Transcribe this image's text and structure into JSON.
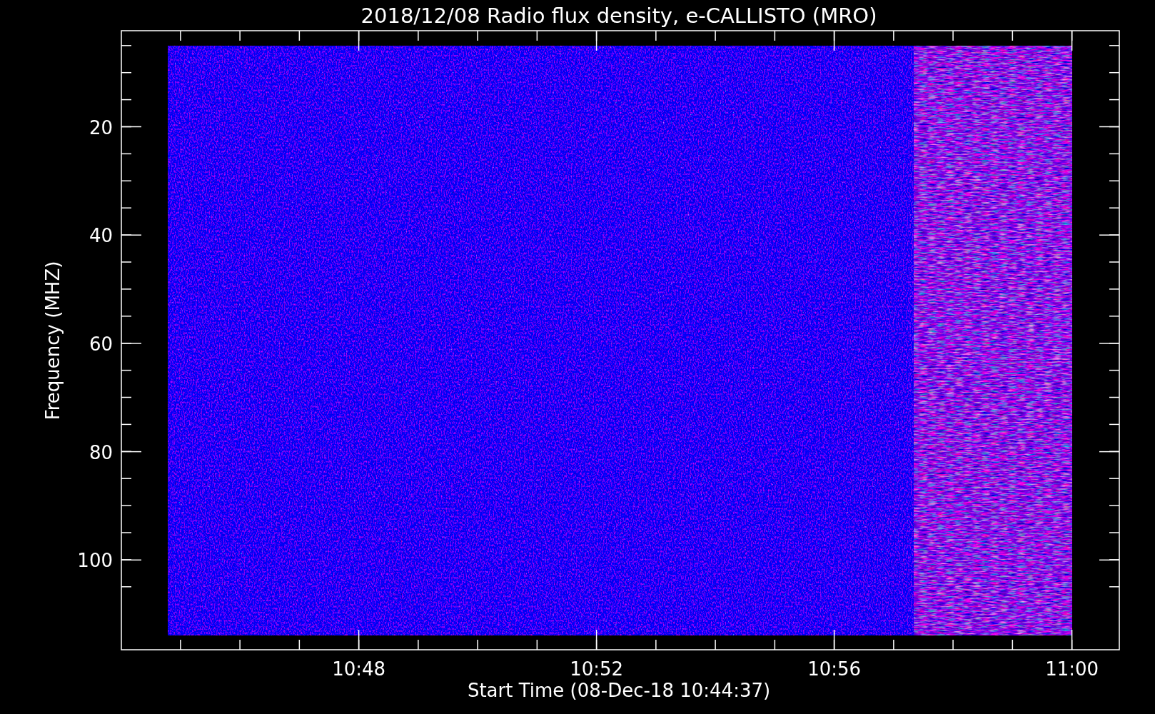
{
  "title": "2018/12/08  Radio flux density, e-CALLISTO (MRO)",
  "y_axis": {
    "label": "Frequency (MHZ)",
    "ticks": [
      "20",
      "40",
      "60",
      "80",
      "100"
    ]
  },
  "x_axis": {
    "label": "Start Time (08-Dec-18 10:44:37)",
    "ticks": [
      "10:48",
      "10:52",
      "10:56",
      "11:00"
    ]
  }
}
